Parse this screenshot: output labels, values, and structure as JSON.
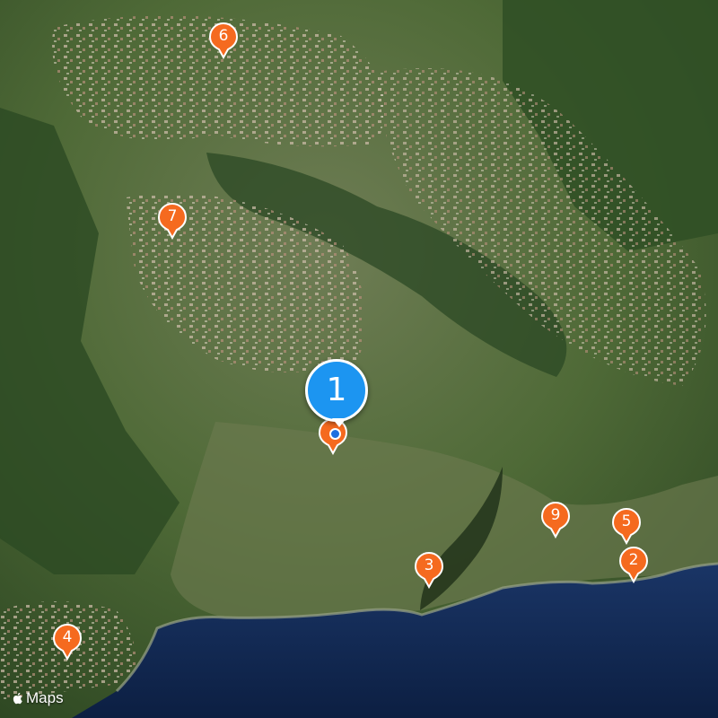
{
  "map": {
    "type": "satellite",
    "land_color": "#4d6a36",
    "sea_color": "#0f2347"
  },
  "selected_place": {
    "label": "1",
    "color": "#1c95f1"
  },
  "pins": [
    {
      "id": "6",
      "label": "6",
      "color": "#f56a1f"
    },
    {
      "id": "7",
      "label": "7",
      "color": "#f56a1f"
    },
    {
      "id": "9",
      "label": "9",
      "color": "#f56a1f"
    },
    {
      "id": "5",
      "label": "5",
      "color": "#f56a1f"
    },
    {
      "id": "2",
      "label": "2",
      "color": "#f56a1f"
    },
    {
      "id": "3",
      "label": "3",
      "color": "#f56a1f"
    },
    {
      "id": "4",
      "label": "4",
      "color": "#f56a1f"
    }
  ],
  "attribution": {
    "icon": "apple-logo-icon",
    "label": "Maps"
  }
}
